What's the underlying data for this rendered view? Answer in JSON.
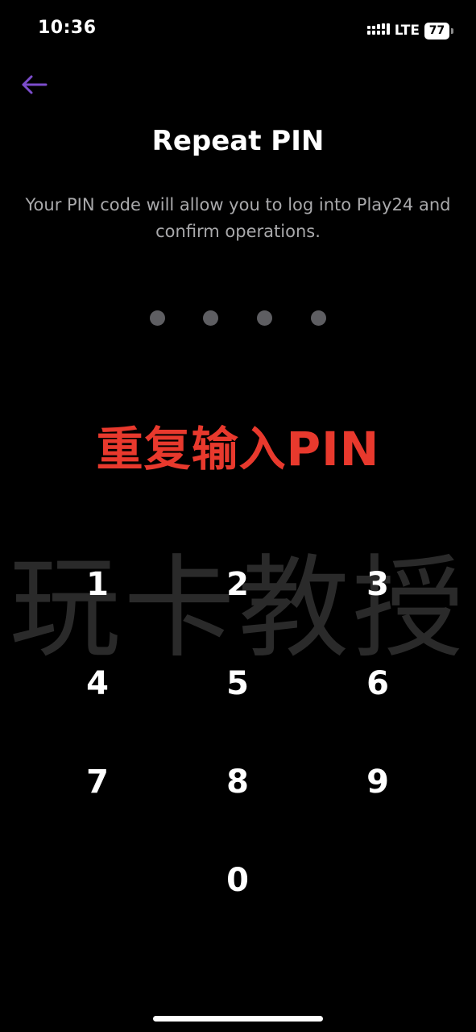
{
  "status_bar": {
    "time": "10:36",
    "network": "LTE",
    "battery": "77"
  },
  "header": {
    "back_icon": "arrow-left-icon",
    "accent_color": "#7c4dcc",
    "title": "Repeat PIN",
    "subtitle": "Your PIN code will allow you to log into Play24 and confirm operations."
  },
  "pin": {
    "length": 4,
    "entered": 0
  },
  "overlay": {
    "caption": "重复输入PIN",
    "caption_color": "#e8392d",
    "watermark": "玩卡教授"
  },
  "keypad": {
    "keys": [
      "1",
      "2",
      "3",
      "4",
      "5",
      "6",
      "7",
      "8",
      "9",
      "0"
    ]
  }
}
